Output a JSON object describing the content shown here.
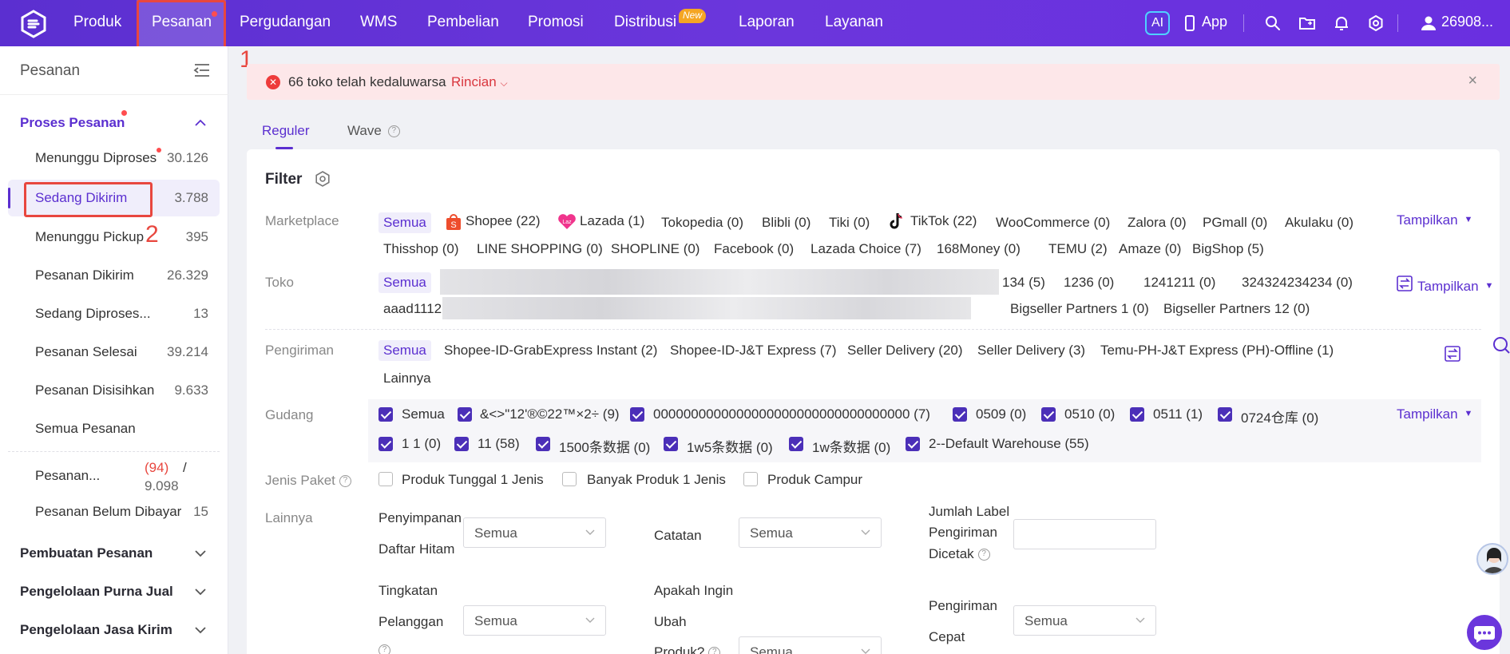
{
  "topnav": {
    "items": [
      {
        "label": "Produk",
        "active": false
      },
      {
        "label": "Pesanan",
        "active": true
      },
      {
        "label": "Pergudangan",
        "active": false
      },
      {
        "label": "WMS",
        "active": false
      },
      {
        "label": "Pembelian",
        "active": false
      },
      {
        "label": "Promosi",
        "active": false
      },
      {
        "label": "Distribusi",
        "active": false,
        "badge": "New"
      },
      {
        "label": "Laporan",
        "active": false
      },
      {
        "label": "Layanan",
        "active": false
      }
    ],
    "ai_label": "AI",
    "app_label": "App",
    "user_label": "26908..."
  },
  "annotations": {
    "step1": "1",
    "step2": "2"
  },
  "sidebar": {
    "title": "Pesanan",
    "groups": [
      {
        "label": "Proses Pesanan",
        "expanded": true
      },
      {
        "label": "Pembuatan Pesanan"
      },
      {
        "label": "Pengelolaan Purna Jual"
      },
      {
        "label": "Pengelolaan Jasa Kirim"
      }
    ],
    "items": [
      {
        "label": "Menunggu Diproses",
        "count": "30.126"
      },
      {
        "label": "Sedang Dikirim",
        "count": "3.788"
      },
      {
        "label": "Menunggu Pickup",
        "count": "395"
      },
      {
        "label": "Pesanan Dikirim",
        "count": "26.329"
      },
      {
        "label": "Sedang Diproses...",
        "count": "13"
      },
      {
        "label": "Pesanan Selesai",
        "count": "39.214"
      },
      {
        "label": "Pesanan Disisihkan",
        "count": "9.633"
      },
      {
        "label": "Semua Pesanan",
        "count": ""
      },
      {
        "label": "Pesanan...",
        "count_red": "(94)",
        "count_sep": "/",
        "count_total": "9.098"
      },
      {
        "label": "Pesanan Belum Dibayar",
        "count": "15"
      }
    ]
  },
  "alert": {
    "message": "66 toko telah kedaluwarsa",
    "link": "Rincian",
    "close": "×"
  },
  "tabs": [
    {
      "label": "Reguler"
    },
    {
      "label": "Wave"
    }
  ],
  "filter": {
    "title": "Filter",
    "show_label": "Tampilkan",
    "marketplace": {
      "label": "Marketplace",
      "options": [
        "Semua",
        "Shopee (22)",
        "Lazada (1)",
        "Tokopedia (0)",
        "Blibli (0)",
        "Tiki (0)",
        "TikTok (22)",
        "WooCommerce (0)",
        "Zalora (0)",
        "PGmall (0)",
        "Akulaku (0)",
        "Thisshop (0)",
        "LINE SHOPPING (0)",
        "SHOPLINE (0)",
        "Facebook (0)",
        "Lazada Choice (7)",
        "168Money (0)",
        "TEMU (2)",
        "Amaze (0)",
        "BigShop (5)"
      ]
    },
    "toko": {
      "label": "Toko",
      "options": [
        "Semua",
        "134 (5)",
        "1236 (0)",
        "1241211 (0)",
        "324324234234 (0)",
        "aaad1112",
        "Bigseller Partners 1 (0)",
        "Bigseller Partners 12 (0)"
      ]
    },
    "pengiriman": {
      "label": "Pengiriman",
      "options": [
        "Semua",
        "Shopee-ID-GrabExpress Instant (2)",
        "Shopee-ID-J&T Express (7)",
        "Seller Delivery (20)",
        "Seller Delivery (3)",
        "Temu-PH-J&T Express (PH)-Offline (1)",
        "Lainnya"
      ]
    },
    "gudang": {
      "label": "Gudang",
      "options": [
        "Semua",
        "&<>\"12'®©22™×2÷ (9)",
        "0000000000000000000000000000000000 (7)",
        "0509 (0)",
        "0510 (0)",
        "0511 (1)",
        "0724仓库 (0)",
        "1 1 (0)",
        "11 (58)",
        "1500条数据 (0)",
        "1w5条数据 (0)",
        "1w条数据 (0)",
        "2--Default Warehouse (55)"
      ]
    },
    "jenis_paket": {
      "label": "Jenis Paket",
      "options": [
        "Produk Tunggal 1 Jenis",
        "Banyak Produk 1 Jenis",
        "Produk Campur"
      ]
    },
    "lainnya": {
      "label": "Lainnya",
      "penyimpanan_l1": "Penyimpanan",
      "penyimpanan_l2": "Daftar Hitam",
      "catatan": "Catatan",
      "jumlah_l1": "Jumlah Label",
      "jumlah_l2": "Pengiriman",
      "jumlah_l3": "Dicetak",
      "tingkatan_l1": "Tingkatan",
      "tingkatan_l2": "Pelanggan",
      "ubah_l1": "Apakah Ingin",
      "ubah_l2": "Ubah",
      "ubah_l3": "Produk?",
      "cepat_l1": "Pengiriman",
      "cepat_l2": "Cepat",
      "select_value": "Semua"
    }
  }
}
